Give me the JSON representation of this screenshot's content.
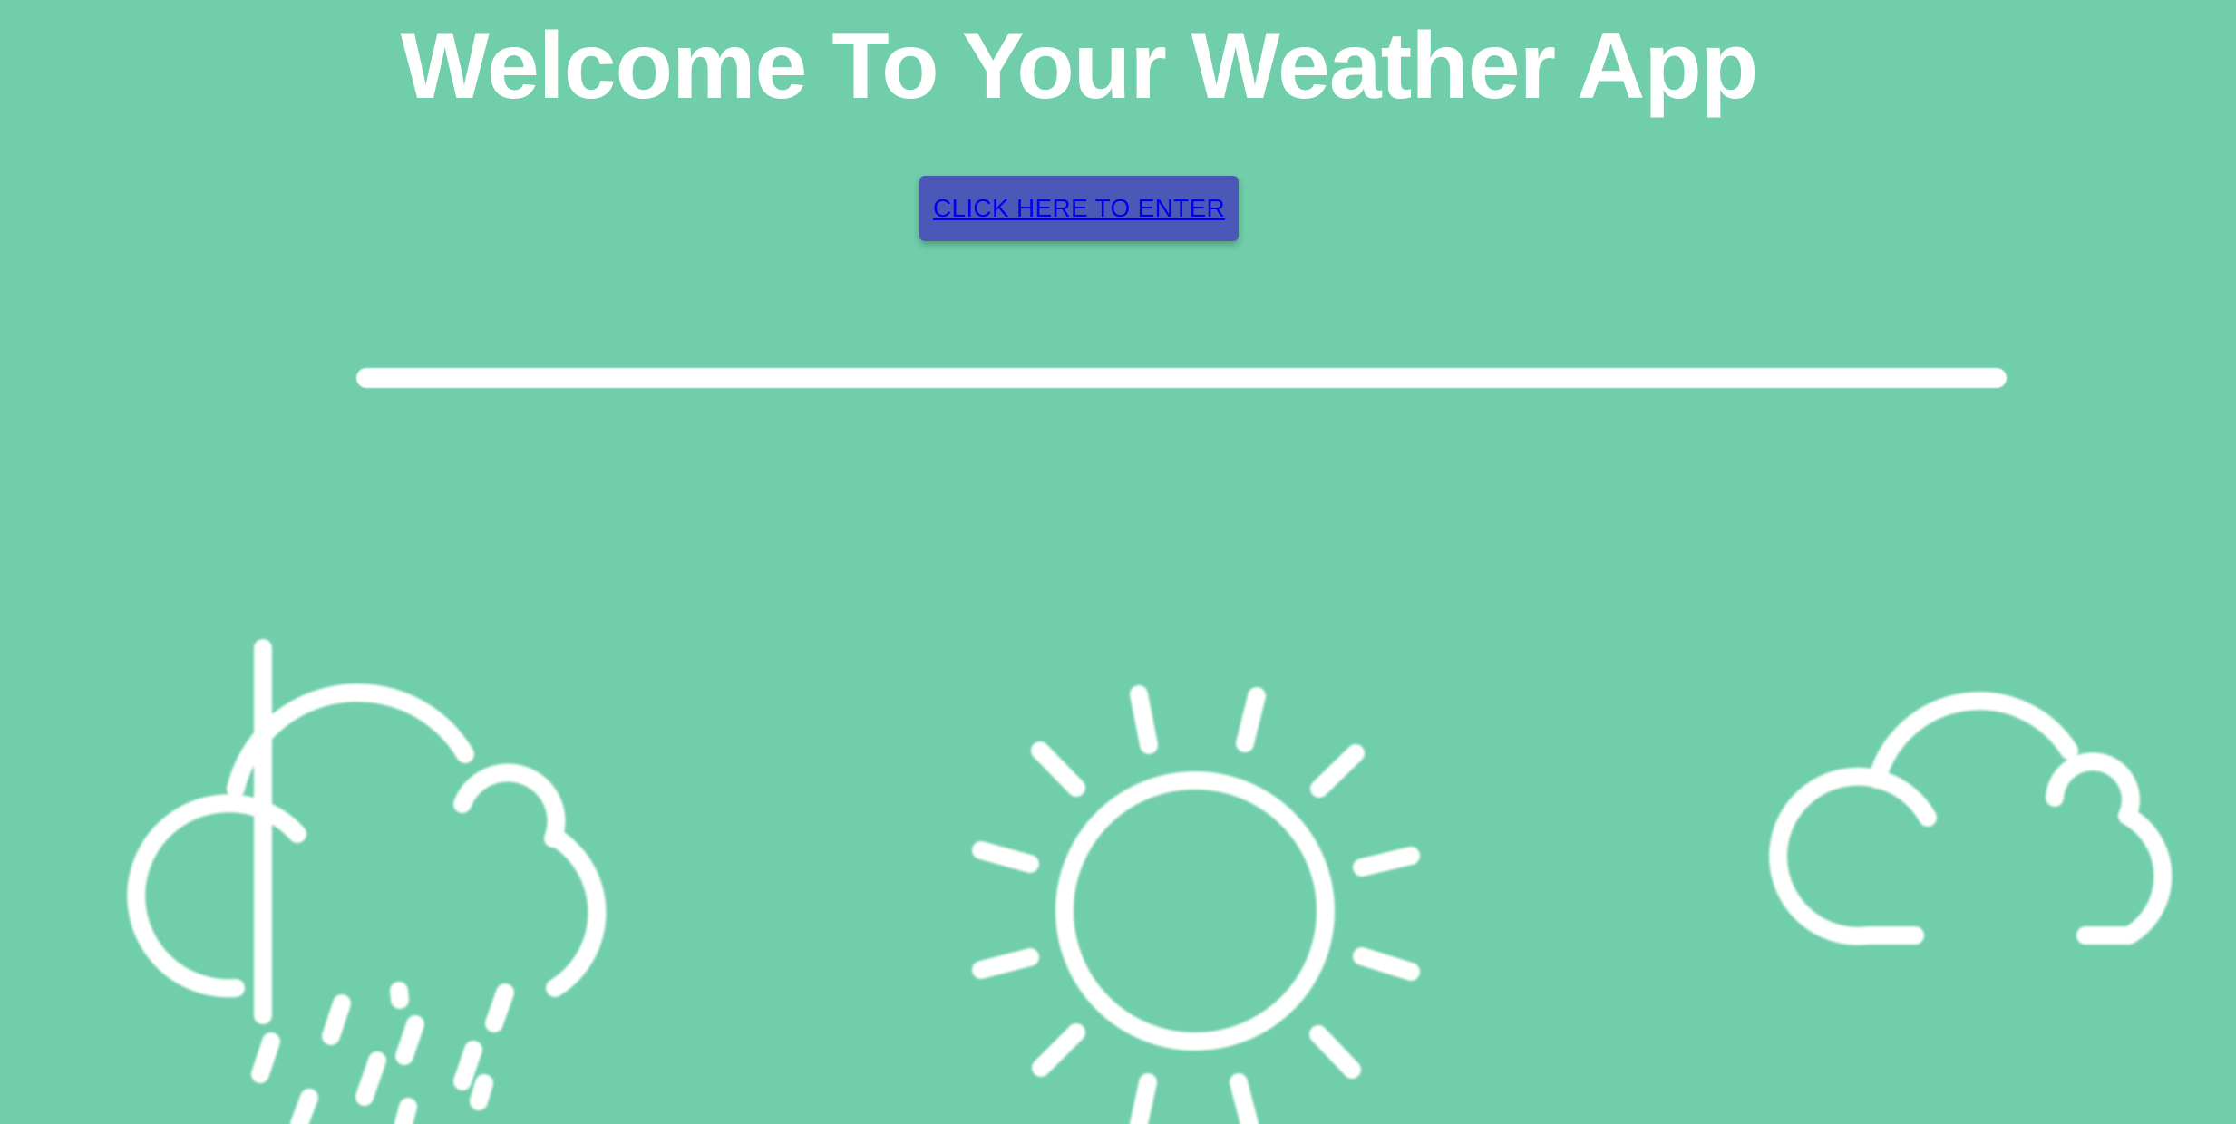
{
  "page": {
    "title": "Welcome To Your Weather App",
    "background_color": "#70CEAA"
  },
  "enter_button": {
    "label": "CLICK HERE TO ENTER",
    "background_color": "#4B58B8",
    "link_color": "#0000EE"
  },
  "icons": {
    "left": "rain-cloud-icon",
    "center": "sun-icon",
    "right": "cloud-icon"
  }
}
